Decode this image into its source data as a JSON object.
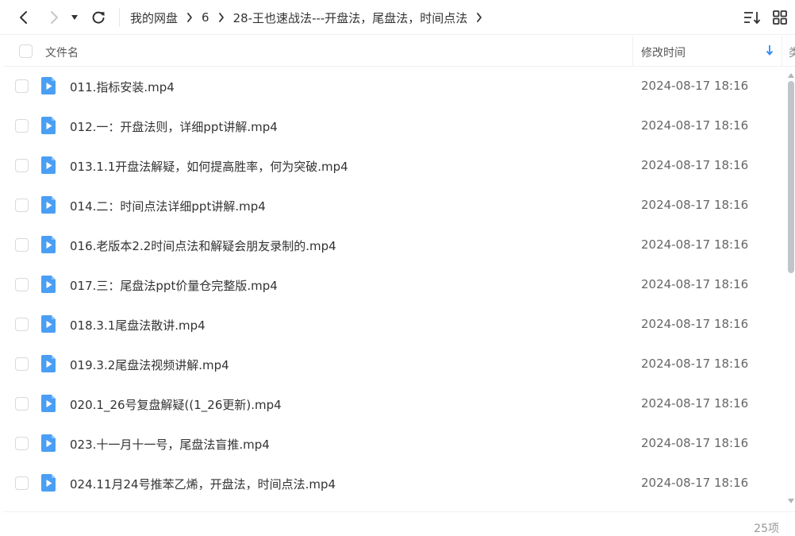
{
  "toolbar": {
    "breadcrumb": [
      {
        "label": "我的网盘"
      },
      {
        "label": "6"
      },
      {
        "label": "28-王也速战法---开盘法，尾盘法，时间点法"
      }
    ]
  },
  "header": {
    "name_label": "文件名",
    "mtime_label": "修改时间",
    "type_label": "类"
  },
  "files": [
    {
      "name": "011.指标安装.mp4",
      "modified": "2024-08-17 18:16"
    },
    {
      "name": "012.一：开盘法则，详细ppt讲解.mp4",
      "modified": "2024-08-17 18:16"
    },
    {
      "name": "013.1.1开盘法解疑，如何提高胜率，何为突破.mp4",
      "modified": "2024-08-17 18:16"
    },
    {
      "name": "014.二：时间点法详细ppt讲解.mp4",
      "modified": "2024-08-17 18:16"
    },
    {
      "name": "016.老版本2.2时间点法和解疑会朋友录制的.mp4",
      "modified": "2024-08-17 18:16"
    },
    {
      "name": "017.三：尾盘法ppt价量仓完整版.mp4",
      "modified": "2024-08-17 18:16"
    },
    {
      "name": "018.3.1尾盘法散讲.mp4",
      "modified": "2024-08-17 18:16"
    },
    {
      "name": "019.3.2尾盘法视频讲解.mp4",
      "modified": "2024-08-17 18:16"
    },
    {
      "name": "020.1_26号复盘解疑((1_26更新).mp4",
      "modified": "2024-08-17 18:16"
    },
    {
      "name": "023.十一月十一号，尾盘法盲推.mp4",
      "modified": "2024-08-17 18:16"
    },
    {
      "name": "024.11月24号推苯乙烯，开盘法，时间点法.mp4",
      "modified": "2024-08-17 18:16"
    }
  ],
  "footer": {
    "count_label": "25项"
  },
  "colors": {
    "video_icon": "#4a9ff5",
    "sort_arrow": "#2f8ef6"
  },
  "icons": {
    "back": "chevron-left-icon",
    "forward": "chevron-right-icon",
    "dropdown": "caret-down-icon",
    "refresh": "refresh-icon",
    "sort": "sort-list-icon",
    "grid": "grid-view-icon",
    "file": "video-file-icon"
  }
}
